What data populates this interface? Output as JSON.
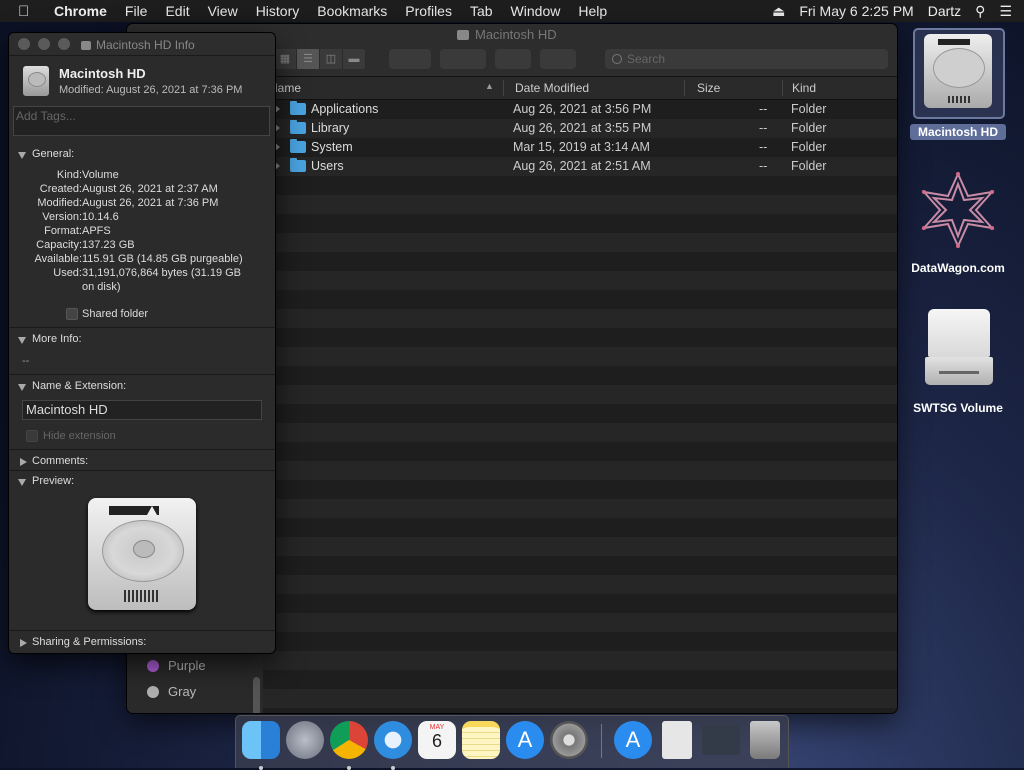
{
  "menubar": {
    "items": [
      "Chrome",
      "File",
      "Edit",
      "View",
      "History",
      "Bookmarks",
      "Profiles",
      "Tab",
      "Window",
      "Help"
    ],
    "clock": "Fri May 6  2:25 PM",
    "user": "Dartz"
  },
  "finder": {
    "title": "Macintosh HD",
    "search_placeholder": "Search",
    "columns": {
      "name": "Name",
      "date": "Date Modified",
      "size": "Size",
      "kind": "Kind"
    },
    "rows": [
      {
        "name": "Applications",
        "date": "Aug 26, 2021 at 3:56 PM",
        "size": "--",
        "kind": "Folder"
      },
      {
        "name": "Library",
        "date": "Aug 26, 2021 at 3:55 PM",
        "size": "--",
        "kind": "Folder"
      },
      {
        "name": "System",
        "date": "Mar 15, 2019 at 3:14 AM",
        "size": "--",
        "kind": "Folder"
      },
      {
        "name": "Users",
        "date": "Aug 26, 2021 at 2:51 AM",
        "size": "--",
        "kind": "Folder"
      }
    ],
    "tags": [
      {
        "label": "Purple",
        "color": "#b05ed8"
      },
      {
        "label": "Gray",
        "color": "#b0b0b0"
      }
    ]
  },
  "info": {
    "window_title": "Macintosh HD Info",
    "name": "Macintosh HD",
    "modified": "Modified: August 26, 2021 at 7:36 PM",
    "tags_placeholder": "Add Tags...",
    "general_label": "General:",
    "general": [
      {
        "k": "Kind:",
        "v": "Volume"
      },
      {
        "k": "Created:",
        "v": "August 26, 2021 at 2:37 AM"
      },
      {
        "k": "Modified:",
        "v": "August 26, 2021 at 7:36 PM"
      },
      {
        "k": "Version:",
        "v": "10.14.6"
      },
      {
        "k": "Format:",
        "v": "APFS"
      },
      {
        "k": "Capacity:",
        "v": "137.23 GB"
      },
      {
        "k": "Available:",
        "v": "115.91 GB (14.85 GB purgeable)"
      },
      {
        "k": "Used:",
        "v": "31,191,076,864 bytes (31.19 GB"
      }
    ],
    "used_cont": "on disk)",
    "shared_folder": "Shared folder",
    "more_info_label": "More Info:",
    "more_info_value": "--",
    "name_ext_label": "Name & Extension:",
    "name_field": "Macintosh HD",
    "hide_extension": "Hide extension",
    "comments_label": "Comments:",
    "preview_label": "Preview:",
    "sharing_label": "Sharing & Permissions:"
  },
  "desktop": {
    "icons": [
      {
        "label": "Macintosh HD"
      },
      {
        "label": "DataWagon.com"
      },
      {
        "label": "SWTSG Volume"
      }
    ]
  },
  "dock": {
    "apps": [
      {
        "name": "Finder",
        "color": "#3a8fe0"
      },
      {
        "name": "Launchpad",
        "color": "#8a8f9a"
      },
      {
        "name": "Chrome",
        "color": "#e04a3a"
      },
      {
        "name": "Safari",
        "color": "#2f8de0"
      },
      {
        "name": "Calendar",
        "color": "#f4f4f4",
        "month": "MAY",
        "day": "6"
      },
      {
        "name": "Notes",
        "color": "#f7d85a"
      },
      {
        "name": "App Store",
        "color": "#2b8cf0"
      },
      {
        "name": "System Preferences",
        "color": "#8b8b8b"
      },
      {
        "name": "App Store Downloads",
        "color": "#2b8cf0"
      },
      {
        "name": "Document",
        "color": "#e6e6e6"
      },
      {
        "name": "Screen",
        "color": "#333a48"
      },
      {
        "name": "Trash",
        "color": "#9a9a9a"
      }
    ]
  }
}
